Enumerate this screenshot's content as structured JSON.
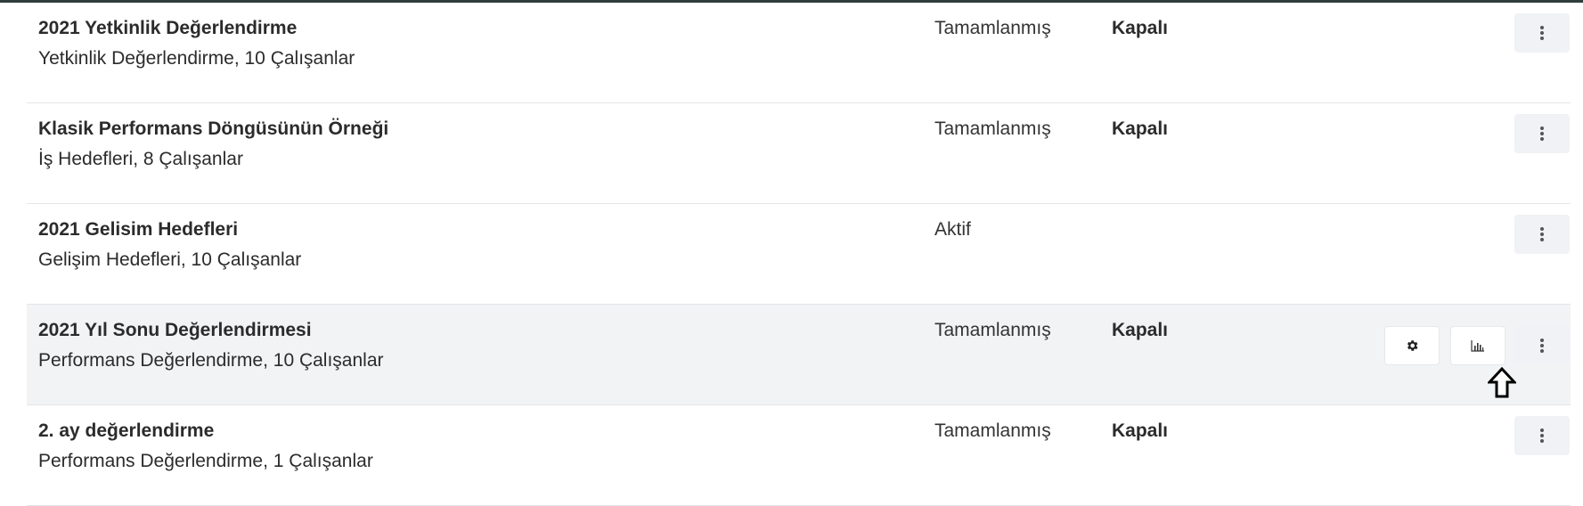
{
  "rows": [
    {
      "title": "2021 Yetkinlik Değerlendirme",
      "subtitle": "Yetkinlik Değerlendirme, 10 Çalışanlar",
      "status": "Tamamlanmış",
      "visibility": "Kapalı"
    },
    {
      "title": "Klasik Performans Döngüsünün Örneği",
      "subtitle": "İş Hedefleri, 8 Çalışanlar",
      "status": "Tamamlanmış",
      "visibility": "Kapalı"
    },
    {
      "title": "2021 Gelisim Hedefleri",
      "subtitle": "Gelişim Hedefleri, 10 Çalışanlar",
      "status": "Aktif",
      "visibility": ""
    },
    {
      "title": "2021 Yıl Sonu Değerlendirmesi",
      "subtitle": "Performans Değerlendirme, 10 Çalışanlar",
      "status": "Tamamlanmış",
      "visibility": "Kapalı"
    },
    {
      "title": "2. ay değerlendirme",
      "subtitle": "Performans Değerlendirme, 1 Çalışanlar",
      "status": "Tamamlanmış",
      "visibility": "Kapalı"
    }
  ],
  "icons": {
    "more": "more-vertical-icon",
    "settings": "gear-icon",
    "report": "bar-chart-icon",
    "cursor": "up-arrow-cursor-icon"
  },
  "colors": {
    "top_border": "#2f3d3b",
    "hover_row_bg": "#f2f3f5",
    "button_bg": "#f0f2f5"
  }
}
